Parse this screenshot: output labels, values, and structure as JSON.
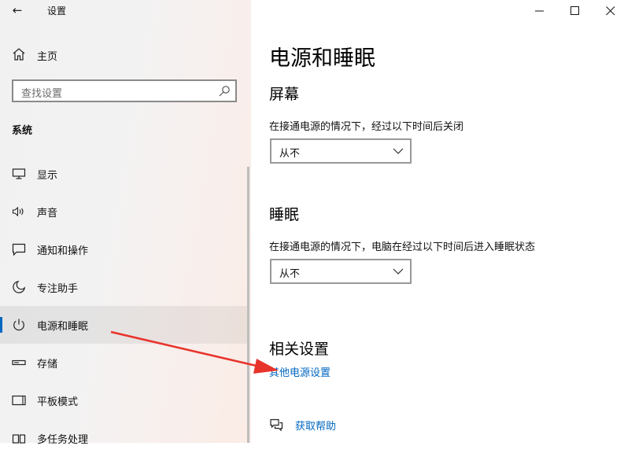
{
  "window": {
    "title": "设置",
    "back_glyph": "←"
  },
  "sidebar": {
    "home_label": "主页",
    "search_placeholder": "查找设置",
    "section_label": "系统",
    "items": [
      {
        "label": "显示",
        "icon": "monitor-icon",
        "active": false
      },
      {
        "label": "声音",
        "icon": "speaker-icon",
        "active": false
      },
      {
        "label": "通知和操作",
        "icon": "message-icon",
        "active": false
      },
      {
        "label": "专注助手",
        "icon": "moon-icon",
        "active": false
      },
      {
        "label": "电源和睡眠",
        "icon": "power-icon",
        "active": true
      },
      {
        "label": "存储",
        "icon": "storage-icon",
        "active": false
      },
      {
        "label": "平板模式",
        "icon": "tablet-icon",
        "active": false
      },
      {
        "label": "多任务处理",
        "icon": "multitask-icon",
        "active": false
      }
    ]
  },
  "main": {
    "title": "电源和睡眠",
    "screen": {
      "heading": "屏幕",
      "description": "在接通电源的情况下，经过以下时间后关闭",
      "value": "从不"
    },
    "sleep": {
      "heading": "睡眠",
      "description": "在接通电源的情况下，电脑在经过以下时间后进入睡眠状态",
      "value": "从不"
    },
    "related": {
      "heading": "相关设置",
      "link": "其他电源设置"
    },
    "help_link": "获取帮助"
  },
  "colors": {
    "accent": "#0067c0",
    "annotation_arrow": "#e8332b"
  }
}
